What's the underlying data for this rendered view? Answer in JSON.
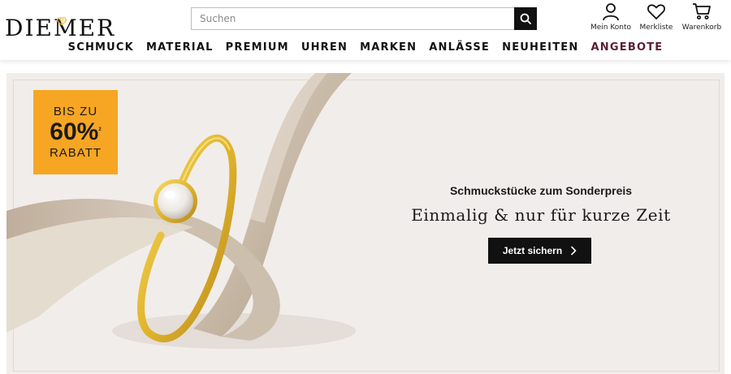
{
  "brand": {
    "logo_text": "DIEMER",
    "logo_icon": "gem-icon",
    "gold": "#e4b63c"
  },
  "search": {
    "placeholder": "Suchen",
    "value": "",
    "icon": "search-icon"
  },
  "header_actions": [
    {
      "label": "Mein Konto",
      "icon": "user-icon"
    },
    {
      "label": "Merkliste",
      "icon": "heart-icon"
    },
    {
      "label": "Warenkorb",
      "icon": "cart-icon"
    }
  ],
  "nav": {
    "items": [
      {
        "label": "SCHMUCK"
      },
      {
        "label": "MATERIAL"
      },
      {
        "label": "PREMIUM"
      },
      {
        "label": "UHREN"
      },
      {
        "label": "MARKEN"
      },
      {
        "label": "ANLÄSSE"
      },
      {
        "label": "NEUHEITEN"
      },
      {
        "label": "ANGEBOTE"
      }
    ],
    "accent_color": "#5a1f33"
  },
  "banner": {
    "badge": {
      "line1": "BIS ZU",
      "line2": "60%",
      "footnote": "2",
      "line3": "RABATT",
      "color": "#f6a623"
    },
    "subtitle": "Schmuckstücke zum Sonderpreis",
    "title": "Einmalig & nur für kurze Zeit",
    "cta_label": "Jetzt sichern",
    "cta_icon": "chevron-right-icon",
    "background": "#f1edea"
  }
}
